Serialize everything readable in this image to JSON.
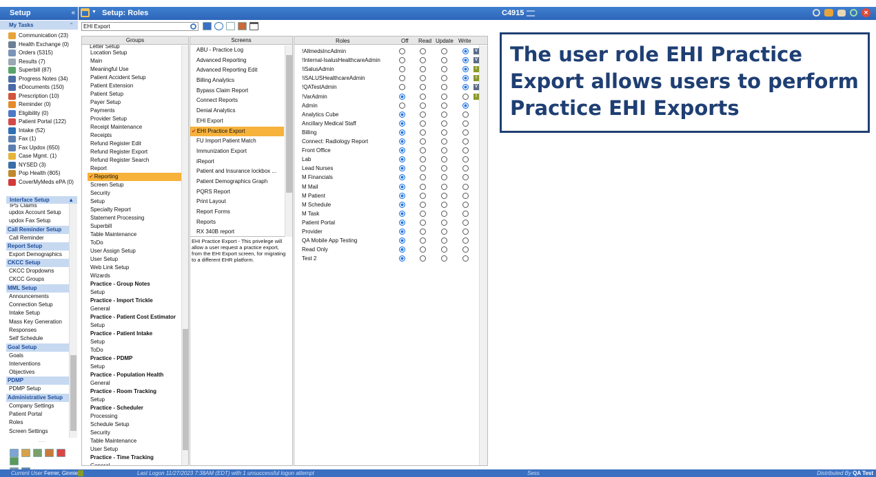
{
  "sidebar": {
    "title": "Setup",
    "collapse_label": "«",
    "my_tasks_label": "My Tasks",
    "my_tasks_caret": "⌃",
    "tasks": [
      {
        "label": "Communication (23)",
        "color": "#e8a43c"
      },
      {
        "label": "Health Exchange (0)",
        "color": "#6d7f94"
      },
      {
        "label": "Orders (5315)",
        "color": "#7b94b8"
      },
      {
        "label": "Results (7)",
        "color": "#9aa7b5"
      },
      {
        "label": "Superbill (87)",
        "color": "#5aa36a"
      },
      {
        "label": "Progress Notes (34)",
        "color": "#4d6fa5"
      },
      {
        "label": "eDocuments (150)",
        "color": "#4a69a8"
      },
      {
        "label": "Prescription (10)",
        "color": "#d2543c"
      },
      {
        "label": "Reminder (0)",
        "color": "#e58b2a"
      },
      {
        "label": "Eligibility (0)",
        "color": "#4b79c6"
      },
      {
        "label": "Patient Portal (122)",
        "color": "#d24a4a"
      },
      {
        "label": "Intake (52)",
        "color": "#2f6fb6"
      },
      {
        "label": "Fax (1)",
        "color": "#5c7fb0"
      },
      {
        "label": "Fax Updox (650)",
        "color": "#5c7fb0"
      },
      {
        "label": "Case Mgmt. (1)",
        "color": "#e6b43a"
      },
      {
        "label": "NYSED (3)",
        "color": "#3a6ea8"
      },
      {
        "label": "Pop Health (805)",
        "color": "#c08a2c"
      },
      {
        "label": "CoverMyMeds ePA (0)",
        "color": "#d23a3a"
      }
    ],
    "interface_label": "Interface Setup",
    "cut_item": "IPS Claims",
    "sections": [
      {
        "type": "link",
        "label": "updox Account Setup"
      },
      {
        "type": "link",
        "label": "updox Fax Setup"
      },
      {
        "type": "sec",
        "label": "Call Reminder Setup"
      },
      {
        "type": "link",
        "label": "Call Reminder"
      },
      {
        "type": "sec",
        "label": "Report Setup"
      },
      {
        "type": "link",
        "label": "Export Demographics"
      },
      {
        "type": "sec",
        "label": "CKCC Setup"
      },
      {
        "type": "link",
        "label": "CKCC Dropdowns"
      },
      {
        "type": "link",
        "label": "CKCC Groups"
      },
      {
        "type": "sec",
        "label": "MML Setup"
      },
      {
        "type": "link",
        "label": "Announcements"
      },
      {
        "type": "link",
        "label": "Connection Setup"
      },
      {
        "type": "link",
        "label": "Intake Setup"
      },
      {
        "type": "link",
        "label": "Mass Key Generation"
      },
      {
        "type": "link",
        "label": "Responses"
      },
      {
        "type": "link",
        "label": "Self Schedule"
      },
      {
        "type": "sec",
        "label": "Goal Setup"
      },
      {
        "type": "link",
        "label": "Goals"
      },
      {
        "type": "link",
        "label": "Interventions"
      },
      {
        "type": "link",
        "label": "Objectives"
      },
      {
        "type": "sec",
        "label": "PDMP"
      },
      {
        "type": "link",
        "label": "PDMP Setup"
      },
      {
        "type": "sec",
        "label": "Administrative Setup"
      },
      {
        "type": "link",
        "label": "Company Settings"
      },
      {
        "type": "link",
        "label": "Patient Portal"
      },
      {
        "type": "link",
        "label": "Roles"
      },
      {
        "type": "link",
        "label": "Screen Settings"
      }
    ]
  },
  "header": {
    "title": "Setup: Roles",
    "code": "C4915",
    "search_value": "EHI Export"
  },
  "groups": {
    "header": "Groups",
    "cut_item": "Letter Setup",
    "items": [
      {
        "label": "Location Setup"
      },
      {
        "label": "Main"
      },
      {
        "label": "Meaningful Use"
      },
      {
        "label": "Patient Accident Setup"
      },
      {
        "label": "Patient Extension"
      },
      {
        "label": "Patient Setup"
      },
      {
        "label": "Payer Setup"
      },
      {
        "label": "Payments"
      },
      {
        "label": "Provider Setup"
      },
      {
        "label": "Receipt Maintenance"
      },
      {
        "label": "Receipts"
      },
      {
        "label": "Refund Register Edit"
      },
      {
        "label": "Refund Register Export"
      },
      {
        "label": "Refund Register Search"
      },
      {
        "label": "Report"
      },
      {
        "label": "Reporting",
        "selected": true
      },
      {
        "label": "Screen Setup"
      },
      {
        "label": "Security"
      },
      {
        "label": "Setup"
      },
      {
        "label": "Specialty Report"
      },
      {
        "label": "Statement Processing"
      },
      {
        "label": "Superbill"
      },
      {
        "label": "Table Maintenance"
      },
      {
        "label": "ToDo"
      },
      {
        "label": "User Assign Setup"
      },
      {
        "label": "User Setup"
      },
      {
        "label": "Web Link Setup"
      },
      {
        "label": "Wizards"
      },
      {
        "label": "Practice - Group Notes",
        "bold": true
      },
      {
        "label": "Setup"
      },
      {
        "label": "Practice - Import Trickle",
        "bold": true
      },
      {
        "label": "General"
      },
      {
        "label": "Practice - Patient Cost Estimator",
        "bold": true
      },
      {
        "label": "Setup"
      },
      {
        "label": "Practice - Patient Intake",
        "bold": true
      },
      {
        "label": "Setup"
      },
      {
        "label": "ToDo"
      },
      {
        "label": "Practice - PDMP",
        "bold": true
      },
      {
        "label": "Setup"
      },
      {
        "label": "Practice - Population Health",
        "bold": true
      },
      {
        "label": "General"
      },
      {
        "label": "Practice - Room Tracking",
        "bold": true
      },
      {
        "label": "Setup"
      },
      {
        "label": "Practice - Scheduler",
        "bold": true
      },
      {
        "label": "Processing"
      },
      {
        "label": "Schedule Setup"
      },
      {
        "label": "Security"
      },
      {
        "label": "Table Maintenance"
      },
      {
        "label": "User Setup"
      },
      {
        "label": "Practice - Time Tracking",
        "bold": true
      },
      {
        "label": "General"
      }
    ]
  },
  "screens": {
    "header": "Screens",
    "items": [
      {
        "label": "ABU - Practice Log"
      },
      {
        "label": "Advanced Reporting"
      },
      {
        "label": "Advanced Reporting Edit"
      },
      {
        "label": "Billing Analytics"
      },
      {
        "label": "Bypass Claim Report"
      },
      {
        "label": "Connect Reports"
      },
      {
        "label": "Denial Analytics"
      },
      {
        "label": "EHI Export"
      },
      {
        "label": "EHI Practice Export",
        "selected": true
      },
      {
        "label": "FU Import Patient Match"
      },
      {
        "label": "Immunization Export"
      },
      {
        "label": "iReport"
      },
      {
        "label": "Patient and Insurance lockbox ..."
      },
      {
        "label": "Patient Demographics Graph"
      },
      {
        "label": "PQRS Report"
      },
      {
        "label": "Print Layout"
      },
      {
        "label": "Report Forms"
      },
      {
        "label": "Reports"
      },
      {
        "label": "RX 340B report"
      }
    ],
    "description": "EHI Practice Export - This privelege will allow a user request a practice export, from the EHI Export screen, for migrating to a different EHR platform."
  },
  "roles": {
    "headers": {
      "name": "Roles",
      "off": "Off",
      "read": "Read",
      "update": "Update",
      "write": "Write"
    },
    "rows": [
      {
        "name": "!AllmedsIncAdmin",
        "level": 3,
        "badge": "V"
      },
      {
        "name": "!Internal-IsalusHealthcareAdmin",
        "level": 3,
        "badge": "V"
      },
      {
        "name": "!iSalusAdmin",
        "level": 3,
        "badge": "I"
      },
      {
        "name": "!iSALUSHealthcareAdmin",
        "level": 3,
        "badge": "I"
      },
      {
        "name": "!QATestAdmin",
        "level": 3,
        "badge": "V"
      },
      {
        "name": "!VarAdmin",
        "level": 0,
        "badge": "I"
      },
      {
        "name": "Admin",
        "level": 3
      },
      {
        "name": "Analytics Cube",
        "level": 0
      },
      {
        "name": "Ancillary Medical Staff",
        "level": 0
      },
      {
        "name": "Billing",
        "level": 0
      },
      {
        "name": "Connect: Radiology Report",
        "level": 0
      },
      {
        "name": "Front Office",
        "level": 0
      },
      {
        "name": "Lab",
        "level": 0
      },
      {
        "name": "Lead Nurses",
        "level": 0
      },
      {
        "name": "M Financials",
        "level": 0
      },
      {
        "name": "M Mail",
        "level": 0
      },
      {
        "name": "M Patient",
        "level": 0
      },
      {
        "name": "M Schedule",
        "level": 0
      },
      {
        "name": "M Task",
        "level": 0
      },
      {
        "name": "Patient Portal",
        "level": 0
      },
      {
        "name": "Provider",
        "level": 0
      },
      {
        "name": "QA Mobile App Testing",
        "level": 0
      },
      {
        "name": "Read Only",
        "level": 0
      },
      {
        "name": "Test 2",
        "level": 0
      }
    ]
  },
  "callout": "The user role EHI Practice Export allows users to perform Practice EHI Exports",
  "status": {
    "current_user_label": "Current User",
    "current_user": "Ferrer, Ginnie",
    "last_logon": "Last Logon  11/27/2023 7:38AM (EDT)  with 1 unsuccessful logon attempt",
    "sess": "Sess",
    "distributed_label": "Distributed By",
    "distributed": "QA Test"
  },
  "colors": {
    "accent": "#2e66b8",
    "selected": "#f6b23b",
    "radio": "#1e74e0",
    "callout_border": "#1f3f73"
  }
}
